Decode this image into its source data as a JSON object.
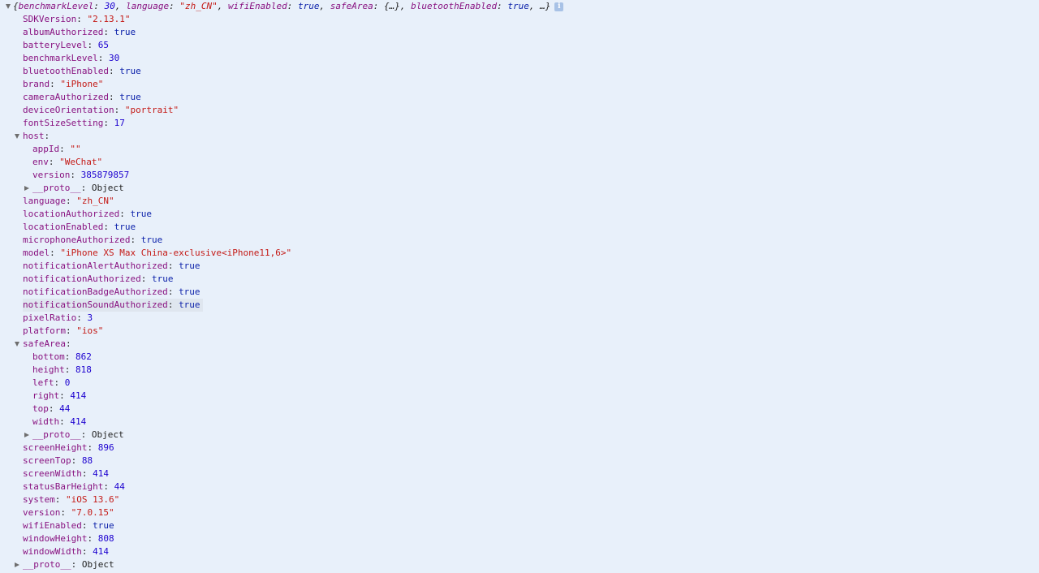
{
  "summary": {
    "open_brace": "{",
    "parts": [
      {
        "key": "benchmarkLevel",
        "value": "30",
        "type": "num"
      },
      {
        "key": "language",
        "value": "\"zh_CN\"",
        "type": "str"
      },
      {
        "key": "wifiEnabled",
        "value": "true",
        "type": "bool"
      },
      {
        "key": "safeArea",
        "value": "{…}",
        "type": "plain"
      },
      {
        "key": "bluetoothEnabled",
        "value": "true",
        "type": "bool"
      }
    ],
    "ellipsis": "…",
    "close_brace": "}",
    "info_icon_label": "i"
  },
  "rows": [
    {
      "level": 1,
      "key": "SDKVersion",
      "value": "\"2.13.1\"",
      "type": "str"
    },
    {
      "level": 1,
      "key": "albumAuthorized",
      "value": "true",
      "type": "bool"
    },
    {
      "level": 1,
      "key": "batteryLevel",
      "value": "65",
      "type": "num"
    },
    {
      "level": 1,
      "key": "benchmarkLevel",
      "value": "30",
      "type": "num"
    },
    {
      "level": 1,
      "key": "bluetoothEnabled",
      "value": "true",
      "type": "bool"
    },
    {
      "level": 1,
      "key": "brand",
      "value": "\"iPhone\"",
      "type": "str"
    },
    {
      "level": 1,
      "key": "cameraAuthorized",
      "value": "true",
      "type": "bool"
    },
    {
      "level": 1,
      "key": "deviceOrientation",
      "value": "\"portrait\"",
      "type": "str"
    },
    {
      "level": 1,
      "key": "fontSizeSetting",
      "value": "17",
      "type": "num"
    },
    {
      "level": 1,
      "key": "host",
      "value": "",
      "type": "plain",
      "expand": "open"
    },
    {
      "level": 2,
      "key": "appId",
      "value": "\"\"",
      "type": "str"
    },
    {
      "level": 2,
      "key": "env",
      "value": "\"WeChat\"",
      "type": "str"
    },
    {
      "level": 2,
      "key": "version",
      "value": "385879857",
      "type": "num"
    },
    {
      "level": 2,
      "key": "__proto__",
      "value": "Object",
      "type": "plain",
      "expand": "closed"
    },
    {
      "level": 1,
      "key": "language",
      "value": "\"zh_CN\"",
      "type": "str"
    },
    {
      "level": 1,
      "key": "locationAuthorized",
      "value": "true",
      "type": "bool"
    },
    {
      "level": 1,
      "key": "locationEnabled",
      "value": "true",
      "type": "bool"
    },
    {
      "level": 1,
      "key": "microphoneAuthorized",
      "value": "true",
      "type": "bool"
    },
    {
      "level": 1,
      "key": "model",
      "value": "\"iPhone XS Max China-exclusive<iPhone11,6>\"",
      "type": "str"
    },
    {
      "level": 1,
      "key": "notificationAlertAuthorized",
      "value": "true",
      "type": "bool"
    },
    {
      "level": 1,
      "key": "notificationAuthorized",
      "value": "true",
      "type": "bool"
    },
    {
      "level": 1,
      "key": "notificationBadgeAuthorized",
      "value": "true",
      "type": "bool"
    },
    {
      "level": 1,
      "key": "notificationSoundAuthorized",
      "value": "true",
      "type": "bool",
      "highlight": true
    },
    {
      "level": 1,
      "key": "pixelRatio",
      "value": "3",
      "type": "num"
    },
    {
      "level": 1,
      "key": "platform",
      "value": "\"ios\"",
      "type": "str"
    },
    {
      "level": 1,
      "key": "safeArea",
      "value": "",
      "type": "plain",
      "expand": "open"
    },
    {
      "level": 2,
      "key": "bottom",
      "value": "862",
      "type": "num"
    },
    {
      "level": 2,
      "key": "height",
      "value": "818",
      "type": "num"
    },
    {
      "level": 2,
      "key": "left",
      "value": "0",
      "type": "num"
    },
    {
      "level": 2,
      "key": "right",
      "value": "414",
      "type": "num"
    },
    {
      "level": 2,
      "key": "top",
      "value": "44",
      "type": "num"
    },
    {
      "level": 2,
      "key": "width",
      "value": "414",
      "type": "num"
    },
    {
      "level": 2,
      "key": "__proto__",
      "value": "Object",
      "type": "plain",
      "expand": "closed"
    },
    {
      "level": 1,
      "key": "screenHeight",
      "value": "896",
      "type": "num"
    },
    {
      "level": 1,
      "key": "screenTop",
      "value": "88",
      "type": "num"
    },
    {
      "level": 1,
      "key": "screenWidth",
      "value": "414",
      "type": "num"
    },
    {
      "level": 1,
      "key": "statusBarHeight",
      "value": "44",
      "type": "num"
    },
    {
      "level": 1,
      "key": "system",
      "value": "\"iOS 13.6\"",
      "type": "str"
    },
    {
      "level": 1,
      "key": "version",
      "value": "\"7.0.15\"",
      "type": "str"
    },
    {
      "level": 1,
      "key": "wifiEnabled",
      "value": "true",
      "type": "bool"
    },
    {
      "level": 1,
      "key": "windowHeight",
      "value": "808",
      "type": "num"
    },
    {
      "level": 1,
      "key": "windowWidth",
      "value": "414",
      "type": "num"
    },
    {
      "level": 1,
      "key": "__proto__",
      "value": "Object",
      "type": "plain",
      "expand": "closed"
    }
  ],
  "colors": {
    "background": "#e8f0fa",
    "key": "#881280",
    "string": "#c41a16",
    "number": "#1c00cf",
    "boolean": "#0d22aa"
  }
}
